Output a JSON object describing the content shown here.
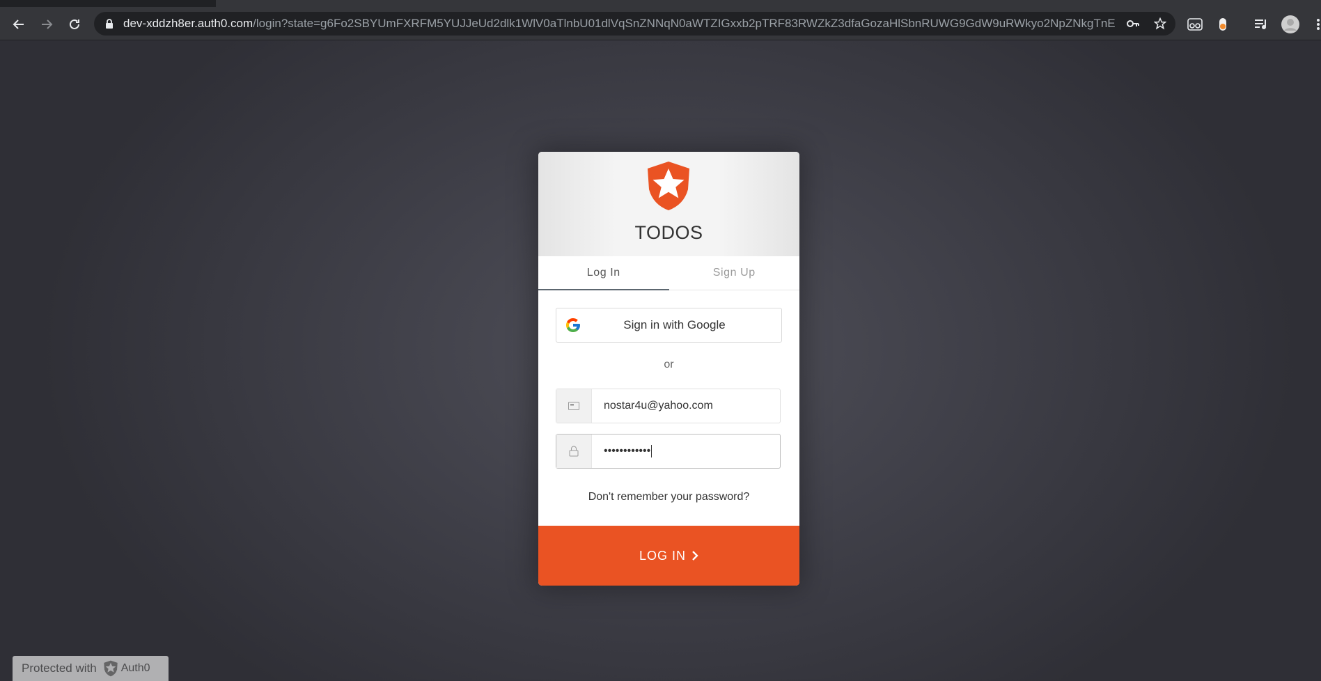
{
  "browser": {
    "url_host": "dev-xddzh8er.auth0.com",
    "url_path": "/login?state=g6Fo2SBYUmFXRFM5YUJJeUd2dlk1WlV0aTlnbU01dlVqSnZNNqN0aWTZIGxxb2pTRF83RWZkZ3dfaGozaHlSbnRUWG9GdW9uRWkyo2NpZNkgTnE..."
  },
  "card": {
    "app_name": "TODOS",
    "tabs": {
      "login": "Log In",
      "signup": "Sign Up"
    },
    "social_button_label": "Sign in with Google",
    "or_label": "or",
    "email_value": "nostar4u@yahoo.com",
    "password_masked": "••••••••••••",
    "forgot_link": "Don't remember your password?",
    "submit_label": "LOG IN",
    "accent_color": "#ea5323"
  },
  "badge": {
    "text": "Protected with",
    "brand": "Auth0"
  }
}
